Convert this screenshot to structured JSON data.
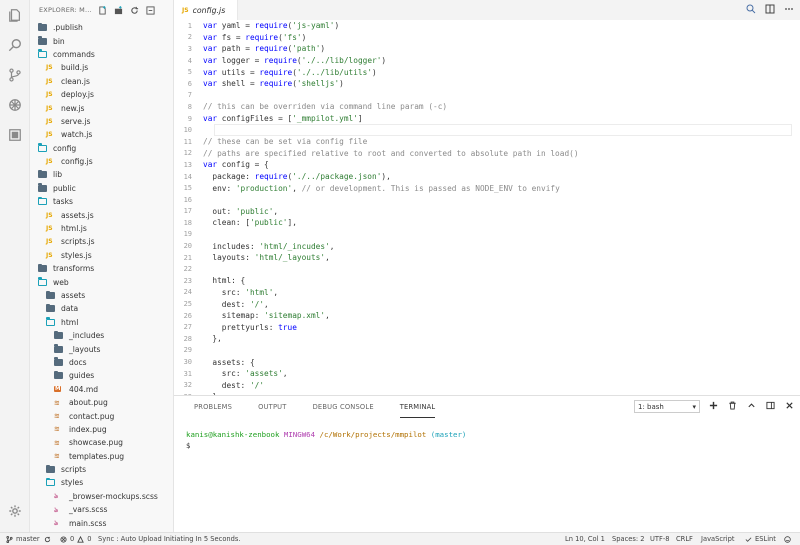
{
  "activity_bar": {
    "icons": [
      "files-icon",
      "search-icon",
      "source-control-icon",
      "debug-icon",
      "extensions-icon",
      "gear-icon"
    ]
  },
  "sidebar": {
    "title": "EXPLORER: M...",
    "tree": [
      {
        "label": ".publish",
        "type": "folder",
        "depth": 0
      },
      {
        "label": "bin",
        "type": "folder",
        "depth": 0
      },
      {
        "label": "commands",
        "type": "folder-open",
        "depth": 0
      },
      {
        "label": "build.js",
        "type": "js",
        "depth": 1
      },
      {
        "label": "clean.js",
        "type": "js",
        "depth": 1
      },
      {
        "label": "deploy.js",
        "type": "js",
        "depth": 1
      },
      {
        "label": "new.js",
        "type": "js",
        "depth": 1
      },
      {
        "label": "serve.js",
        "type": "js",
        "depth": 1
      },
      {
        "label": "watch.js",
        "type": "js",
        "depth": 1
      },
      {
        "label": "config",
        "type": "folder-open",
        "depth": 0
      },
      {
        "label": "config.js",
        "type": "js",
        "depth": 1
      },
      {
        "label": "lib",
        "type": "folder",
        "depth": 0
      },
      {
        "label": "public",
        "type": "folder",
        "depth": 0
      },
      {
        "label": "tasks",
        "type": "folder-open",
        "depth": 0
      },
      {
        "label": "assets.js",
        "type": "js",
        "depth": 1
      },
      {
        "label": "html.js",
        "type": "js",
        "depth": 1
      },
      {
        "label": "scripts.js",
        "type": "js",
        "depth": 1
      },
      {
        "label": "styles.js",
        "type": "js",
        "depth": 1
      },
      {
        "label": "transforms",
        "type": "folder",
        "depth": 0
      },
      {
        "label": "web",
        "type": "folder-open",
        "depth": 0
      },
      {
        "label": "assets",
        "type": "folder",
        "depth": 1
      },
      {
        "label": "data",
        "type": "folder",
        "depth": 1
      },
      {
        "label": "html",
        "type": "folder-open",
        "depth": 1
      },
      {
        "label": "_includes",
        "type": "folder",
        "depth": 2
      },
      {
        "label": "_layouts",
        "type": "folder",
        "depth": 2
      },
      {
        "label": "docs",
        "type": "folder",
        "depth": 2
      },
      {
        "label": "guides",
        "type": "folder",
        "depth": 2
      },
      {
        "label": "404.md",
        "type": "md",
        "depth": 2
      },
      {
        "label": "about.pug",
        "type": "pug",
        "depth": 2
      },
      {
        "label": "contact.pug",
        "type": "pug",
        "depth": 2
      },
      {
        "label": "index.pug",
        "type": "pug",
        "depth": 2
      },
      {
        "label": "showcase.pug",
        "type": "pug",
        "depth": 2
      },
      {
        "label": "templates.pug",
        "type": "pug",
        "depth": 2
      },
      {
        "label": "scripts",
        "type": "folder",
        "depth": 1
      },
      {
        "label": "styles",
        "type": "folder-open",
        "depth": 1
      },
      {
        "label": "_browser-mockups.scss",
        "type": "scss",
        "depth": 2
      },
      {
        "label": "_vars.scss",
        "type": "scss",
        "depth": 2
      },
      {
        "label": "main.scss",
        "type": "scss",
        "depth": 2
      }
    ]
  },
  "editor": {
    "tab_label": "config.js",
    "tab_badge": "JS",
    "lines": [
      [
        [
          "kw",
          "var"
        ],
        [
          "t",
          " yaml = "
        ],
        [
          "kw",
          "require"
        ],
        [
          "t",
          "("
        ],
        [
          "str",
          "'js-yaml'"
        ],
        [
          "t",
          ")"
        ]
      ],
      [
        [
          "kw",
          "var"
        ],
        [
          "t",
          " fs = "
        ],
        [
          "kw",
          "require"
        ],
        [
          "t",
          "("
        ],
        [
          "str",
          "'fs'"
        ],
        [
          "t",
          ")"
        ]
      ],
      [
        [
          "kw",
          "var"
        ],
        [
          "t",
          " path = "
        ],
        [
          "kw",
          "require"
        ],
        [
          "t",
          "("
        ],
        [
          "str",
          "'path'"
        ],
        [
          "t",
          ")"
        ]
      ],
      [
        [
          "kw",
          "var"
        ],
        [
          "t",
          " logger = "
        ],
        [
          "kw",
          "require"
        ],
        [
          "t",
          "("
        ],
        [
          "str",
          "'./../lib/logger'"
        ],
        [
          "t",
          ")"
        ]
      ],
      [
        [
          "kw",
          "var"
        ],
        [
          "t",
          " utils = "
        ],
        [
          "kw",
          "require"
        ],
        [
          "t",
          "("
        ],
        [
          "str",
          "'./../lib/utils'"
        ],
        [
          "t",
          ")"
        ]
      ],
      [
        [
          "kw",
          "var"
        ],
        [
          "t",
          " shell = "
        ],
        [
          "kw",
          "require"
        ],
        [
          "t",
          "("
        ],
        [
          "str",
          "'shelljs'"
        ],
        [
          "t",
          ")"
        ]
      ],
      [],
      [
        [
          "cmt",
          "// this can be overriden via command line param (-c)"
        ]
      ],
      [
        [
          "kw",
          "var"
        ],
        [
          "t",
          " configFiles = ["
        ],
        [
          "str",
          "'_mmpilot.yml'"
        ],
        [
          "t",
          "]"
        ]
      ],
      [],
      [
        [
          "cmt",
          "// these can be set via config file"
        ]
      ],
      [
        [
          "cmt",
          "// paths are specified relative to root and converted to absolute path in load()"
        ]
      ],
      [
        [
          "kw",
          "var"
        ],
        [
          "t",
          " config = {"
        ]
      ],
      [
        [
          "t",
          "  package: "
        ],
        [
          "kw",
          "require"
        ],
        [
          "t",
          "("
        ],
        [
          "str",
          "'./../package.json'"
        ],
        [
          "t",
          "),"
        ]
      ],
      [
        [
          "t",
          "  env: "
        ],
        [
          "str",
          "'production'"
        ],
        [
          "t",
          ", "
        ],
        [
          "cmt",
          "// or development. This is passed as NODE_ENV to envify"
        ]
      ],
      [],
      [
        [
          "t",
          "  out: "
        ],
        [
          "str",
          "'public'"
        ],
        [
          "t",
          ","
        ]
      ],
      [
        [
          "t",
          "  clean: ["
        ],
        [
          "str",
          "'public'"
        ],
        [
          "t",
          "],"
        ]
      ],
      [],
      [
        [
          "t",
          "  includes: "
        ],
        [
          "str",
          "'html/_incudes'"
        ],
        [
          "t",
          ","
        ]
      ],
      [
        [
          "t",
          "  layouts: "
        ],
        [
          "str",
          "'html/_layouts'"
        ],
        [
          "t",
          ","
        ]
      ],
      [],
      [
        [
          "t",
          "  html: {"
        ]
      ],
      [
        [
          "t",
          "    src: "
        ],
        [
          "str",
          "'html'"
        ],
        [
          "t",
          ","
        ]
      ],
      [
        [
          "t",
          "    dest: "
        ],
        [
          "str",
          "'/'"
        ],
        [
          "t",
          ","
        ]
      ],
      [
        [
          "t",
          "    sitemap: "
        ],
        [
          "str",
          "'sitemap.xml'"
        ],
        [
          "t",
          ","
        ]
      ],
      [
        [
          "t",
          "    prettyurls: "
        ],
        [
          "kw",
          "true"
        ]
      ],
      [
        [
          "t",
          "  },"
        ]
      ],
      [],
      [
        [
          "t",
          "  assets: {"
        ]
      ],
      [
        [
          "t",
          "    src: "
        ],
        [
          "str",
          "'assets'"
        ],
        [
          "t",
          ","
        ]
      ],
      [
        [
          "t",
          "    dest: "
        ],
        [
          "str",
          "'/'"
        ]
      ],
      [
        [
          "t",
          "  },"
        ]
      ]
    ],
    "current_line": 10
  },
  "panel": {
    "tabs": [
      "PROBLEMS",
      "OUTPUT",
      "DEBUG CONSOLE",
      "TERMINAL"
    ],
    "active_tab": "TERMINAL",
    "terminal_select": "1: bash",
    "prompt": {
      "user": "kanis@kanishk-zenbook",
      "system": "MINGW64",
      "path": "/c/Work/projects/mmpilot",
      "branch": "(master)"
    },
    "cursor_line": "$"
  },
  "status_bar": {
    "branch": "master",
    "errors": "0",
    "warnings": "0",
    "sync": "Sync : Auto Upload Initiating In 5 Seconds.",
    "position": "Ln 10, Col 1",
    "spaces": "Spaces: 2",
    "encoding": "UTF-8",
    "eol": "CRLF",
    "language": "JavaScript",
    "linter": "ESLint"
  },
  "colors": {
    "keyword": "#0000ff",
    "string": "#2e7d32",
    "comment": "#8a8a8a",
    "folder": "#556b7d",
    "folder_open": "#1ba1b8",
    "js_badge": "#e6a700"
  }
}
